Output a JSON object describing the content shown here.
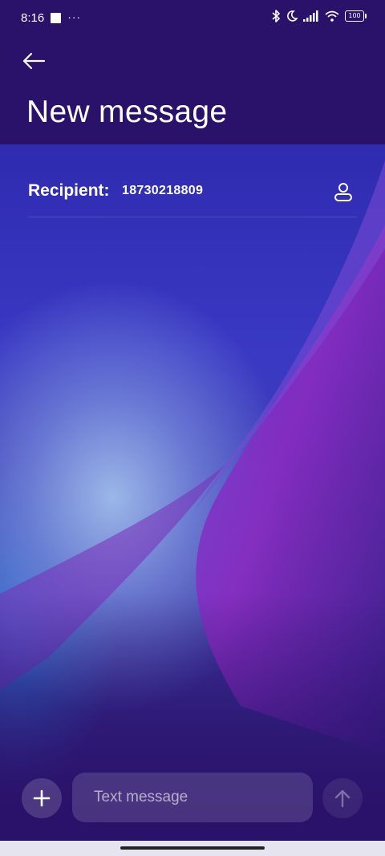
{
  "status_bar": {
    "time": "8:16",
    "more_indicator": "···",
    "battery": "100",
    "icons": [
      "app-square-icon",
      "bluetooth-icon",
      "moon-icon",
      "signal-icon",
      "wifi-icon",
      "battery-icon"
    ]
  },
  "header": {
    "back_icon": "arrow-left-icon",
    "title": "New message"
  },
  "recipient": {
    "label": "Recipient:",
    "value": "18730218809",
    "contact_icon": "contact-person-icon"
  },
  "composer": {
    "add_icon": "plus-icon",
    "placeholder": "Text message",
    "value": "",
    "send_icon": "arrow-up-icon"
  },
  "colors": {
    "background": "#2a1169",
    "accent_wallpaper_light": "#a0bee9",
    "wave_purple": "#8a2bc0"
  }
}
